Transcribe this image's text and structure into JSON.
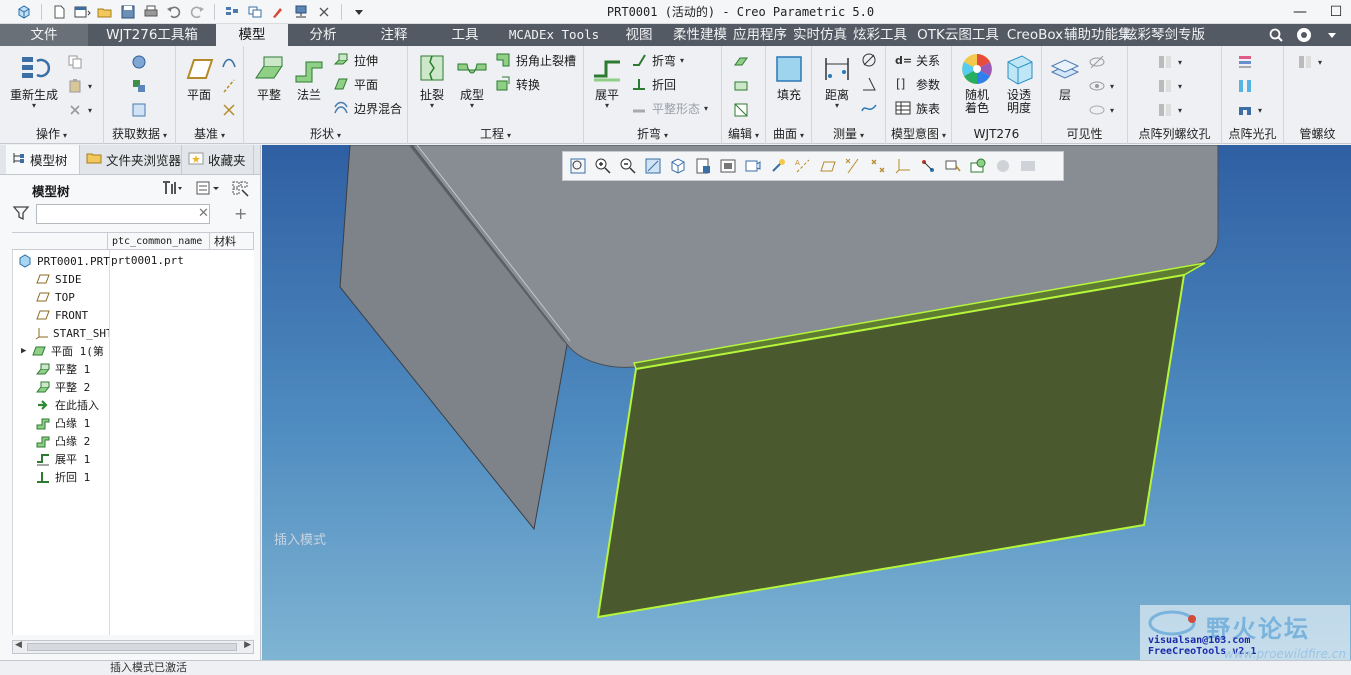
{
  "window": {
    "title": "PRT0001 (活动的) - Creo Parametric 5.0"
  },
  "tabs": [
    {
      "label": "文件",
      "active": false
    },
    {
      "label": "WJT276工具箱",
      "active": false
    },
    {
      "label": "模型",
      "active": true
    },
    {
      "label": "分析",
      "active": false
    },
    {
      "label": "注释",
      "active": false
    },
    {
      "label": "工具",
      "active": false
    },
    {
      "label": "MCADEx Tools",
      "active": false
    },
    {
      "label": "视图",
      "active": false
    },
    {
      "label": "柔性建模",
      "active": false
    },
    {
      "label": "应用程序",
      "active": false
    },
    {
      "label": "实时仿真",
      "active": false
    },
    {
      "label": "炫彩工具",
      "active": false
    },
    {
      "label": "OTK云图工具",
      "active": false
    },
    {
      "label": "CreoBox",
      "active": false
    },
    {
      "label": "辅助功能集",
      "active": false
    },
    {
      "label": "炫彩琴剑专版",
      "active": false
    }
  ],
  "ribbon": {
    "groups": {
      "operations": "操作",
      "get_data": "获取数据",
      "datum": "基准",
      "shapes": "形状",
      "engineering": "工程",
      "bend": "折弯",
      "edit": "编辑",
      "surface": "曲面",
      "measure": "测量",
      "model_intent": "模型意图",
      "wjt276": "WJT276",
      "visibility": "可见性",
      "thread_array": "点阵列螺纹孔",
      "light_hole": "点阵光孔",
      "pipe_thread": "管螺纹"
    },
    "buttons": {
      "regenerate": "重新生成",
      "plane": "平面",
      "flat": "平整",
      "flange": "法兰",
      "extrude": "拉伸",
      "planar": "平面",
      "boundary_blend": "边界混合",
      "rip": "扯裂",
      "form": "成型",
      "corner_relief": "拐角止裂槽",
      "convert": "转换",
      "unbend": "展平",
      "bend": "折弯",
      "bend_back": "折回",
      "flat_state": "平整形态",
      "fill": "填充",
      "distance": "距离",
      "relations": "关系",
      "parameters": "参数",
      "family_table": "族表",
      "random_color": "随机着色",
      "set_transparency": "设透明度",
      "layer": "层"
    }
  },
  "left_panel": {
    "tabs": [
      "模型树",
      "文件夹浏览器",
      "收藏夹"
    ],
    "tree_title": "模型树",
    "filter_placeholder": "",
    "columns": [
      "",
      "ptc_common_name",
      "材料"
    ],
    "rows": [
      {
        "name": "PRT0001.PRT",
        "common_name": "prt0001.prt",
        "icon": "part-icon"
      },
      {
        "name": "SIDE",
        "icon": "datum-plane-icon"
      },
      {
        "name": "TOP",
        "icon": "datum-plane-icon"
      },
      {
        "name": "FRONT",
        "icon": "datum-plane-icon"
      },
      {
        "name": "START_SHT",
        "icon": "coordinate-system-icon"
      },
      {
        "name": "平面 1(第",
        "icon": "planar-wall-icon"
      },
      {
        "name": "平整 1",
        "icon": "flat-wall-icon"
      },
      {
        "name": "平整 2",
        "icon": "flat-wall-icon"
      },
      {
        "name": "在此插入",
        "icon": "insert-here-arrow-icon"
      },
      {
        "name": "凸缘 1",
        "icon": "flange-icon"
      },
      {
        "name": "凸缘 2",
        "icon": "flange-icon"
      },
      {
        "name": "展平 1",
        "icon": "unbend-icon"
      },
      {
        "name": "折回 1",
        "icon": "bend-back-icon"
      }
    ]
  },
  "graphics": {
    "mode_text": "插入模式",
    "watermark": {
      "title": "野火论坛",
      "line1": "visualsan@163.com",
      "line2": "FreeCreoTools v2.1",
      "url": "www.proewildfire.cn"
    }
  },
  "status": {
    "text": "插入模式已激活"
  },
  "colors": {
    "tab_bar": "#545a63",
    "ribbon_bg": "#eef0f3",
    "viewport_top": "#2f5fa3",
    "viewport_bottom": "#7fb4d3",
    "selected_face": "#4a5a2e",
    "highlight_edge": "#b5f53a",
    "model_gray": "#858b92"
  }
}
